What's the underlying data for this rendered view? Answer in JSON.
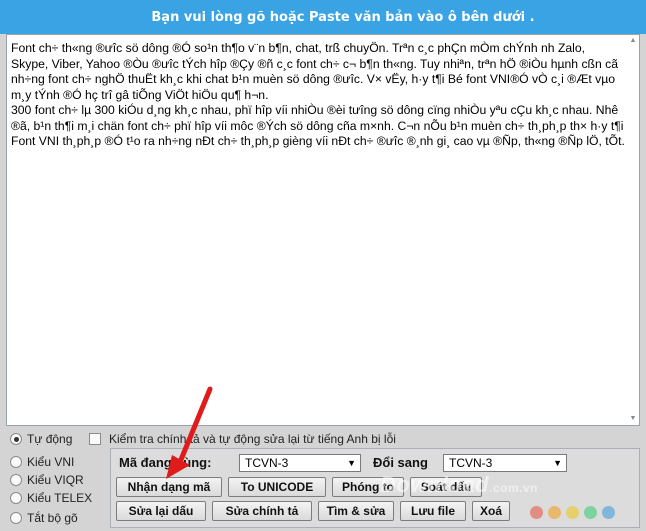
{
  "header": {
    "title": "Bạn vui lòng gõ hoặc Paste văn bản vào ô bên dưới ."
  },
  "editor": {
    "paragraphs": [
      "Font ch÷ th«ng ®ưîc sö dông ®Ó so¹n th¶o v¨n b¶n, chat, trß chuyÖn. Trªn c¸c phÇn mÒm chÝnh nh Zalo, Skype, Viber, Yahoo ®Òu ®ưîc tÝch hîp ®Çy ®ñ c¸c font ch÷ c¬ b¶n th«ng. Tuy nhiªn, trªn hÖ ®iÒu hµnh cßn cã nh÷ng font ch÷ nghÖ thuËt kh¸c khi chat b¹n muèn sö dông ®ưîc. V× vËy, h·y t¶i Bé font VNI®Ó vÒ c¸i ®Æt vµo m¸y tÝnh ®Ó hç trî gâ tiÕng ViÖt hiÖu qu¶ h¬n.",
      "300 font ch÷ lµ 300 kiÓu d¸ng kh¸c nhau, phï hîp víi nhiÒu ®èi tưîng sö dông cïng nhiÒu yªu cÇu kh¸c nhau. Nhê ®ã, b¹n th¶i m¸i chän font ch÷ phï hîp víi môc ®Ých sö dông cña m×nh. C¬n nÕu b¹n muèn ch÷ th¸ph¸p th× h·y t¶i Font VNI th¸ph¸p ®Ó t¹o ra nh÷ng nÐt ch÷ th¸ph¸p gièng víi nÐt ch÷ ®ưîc ®¸nh gi¸ cao vµ ®Ñp, th«ng ®Ñp lÖ, tÕt."
    ]
  },
  "modes": [
    {
      "label": "Tự động",
      "checked": true
    },
    {
      "label": "Kiểu VNI",
      "checked": false
    },
    {
      "label": "Kiểu VIQR",
      "checked": false
    },
    {
      "label": "Kiểu TELEX",
      "checked": false
    },
    {
      "label": "Tắt bộ gõ",
      "checked": false
    }
  ],
  "spellcheck": {
    "label": "Kiểm tra chính tả và tự động sửa lại từ tiếng Anh bị lỗi",
    "checked": false
  },
  "tools": {
    "source_label": "Mã đang dùng:",
    "source_value": "TCVN-3",
    "target_label": "Đổi sang",
    "target_value": "TCVN-3",
    "buttons_row1": [
      "Nhận dạng mã",
      "To UNICODE",
      "Phóng to",
      "Soát dấu"
    ],
    "buttons_row2": [
      "Sửa lại dấu",
      "Sửa chính tả",
      "Tìm & sửa",
      "Lưu file",
      "Xoá"
    ]
  },
  "watermark": {
    "text": "Download",
    "suffix": ".com.vn"
  },
  "colors": {
    "header": "#3aa3e3",
    "arrow": "#e01b1b"
  }
}
